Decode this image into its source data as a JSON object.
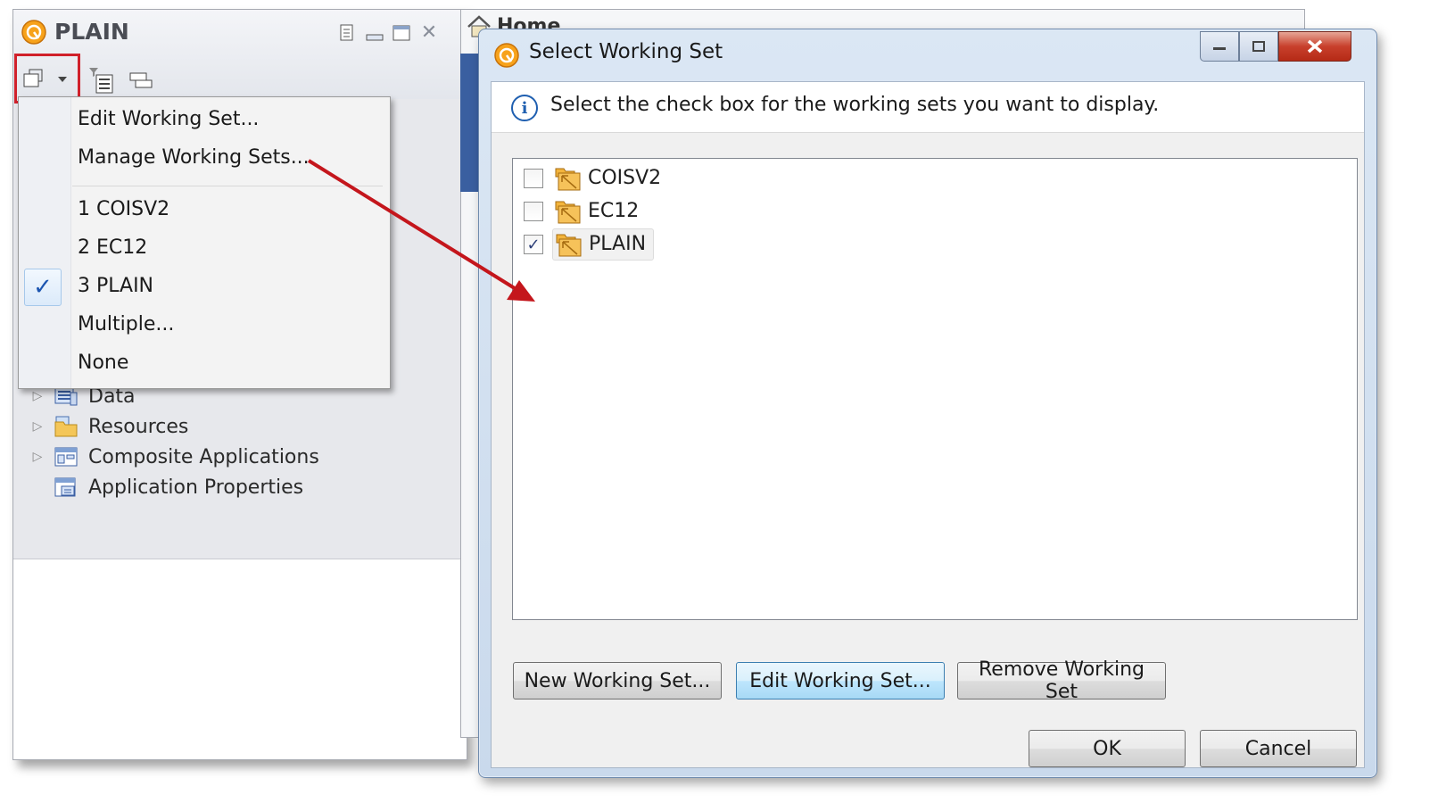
{
  "left_view": {
    "title": "PLAIN",
    "tree": [
      {
        "label": "Data",
        "expandable": true
      },
      {
        "label": "Resources",
        "expandable": true
      },
      {
        "label": "Composite Applications",
        "expandable": true
      },
      {
        "label": "Application Properties",
        "expandable": false
      }
    ]
  },
  "menu": {
    "edit_working_set": "Edit Working Set...",
    "manage_working_sets": "Manage Working Sets...",
    "sets": [
      {
        "label": "1  COISV2",
        "checked": false
      },
      {
        "label": "2  EC12",
        "checked": false
      },
      {
        "label": "3  PLAIN",
        "checked": true
      }
    ],
    "multiple": "Multiple...",
    "none": "None"
  },
  "editor": {
    "tab_partial": "Home"
  },
  "dialog": {
    "title": "Select Working Set",
    "message": "Select the check box for the working sets you want to display.",
    "working_sets": [
      {
        "name": "COISV2",
        "checked": false
      },
      {
        "name": "EC12",
        "checked": false
      },
      {
        "name": "PLAIN",
        "checked": true
      }
    ],
    "buttons": {
      "new": "New Working Set...",
      "edit": "Edit Working Set...",
      "remove": "Remove Working Set",
      "ok": "OK",
      "cancel": "Cancel"
    }
  },
  "colors": {
    "highlight_red": "#d0202a",
    "arrow_red": "#c4161c",
    "check_blue": "#1c55b0"
  }
}
